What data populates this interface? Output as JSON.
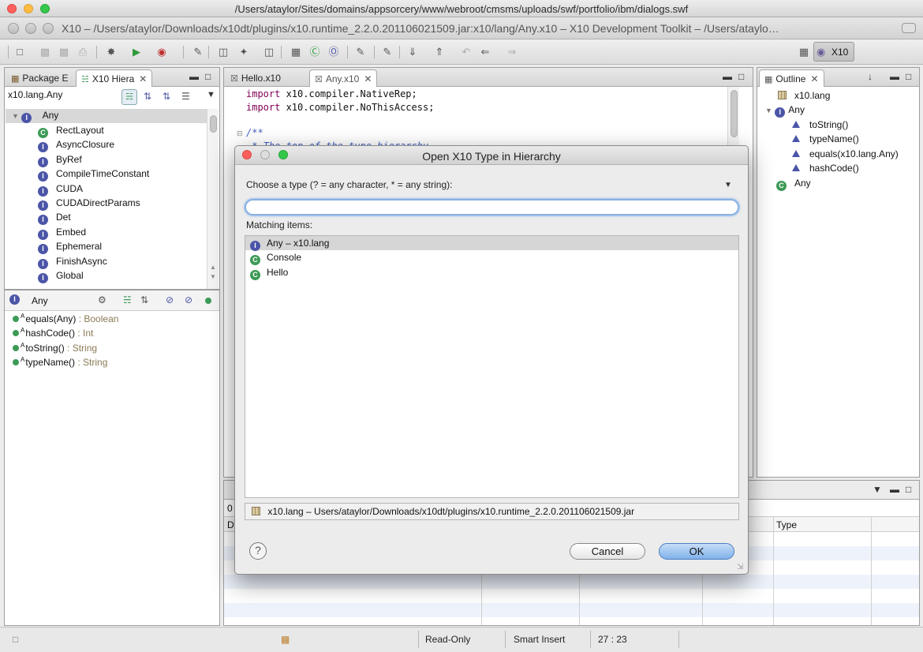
{
  "outer_window": {
    "title": "/Users/ataylor/Sites/domains/appsorcery/www/webroot/cmsms/uploads/swf/portfolio/ibm/dialogs.swf"
  },
  "ide_window": {
    "title": "X10 – /Users/ataylor/Downloads/x10dt/plugins/x10.runtime_2.2.0.201106021509.jar:x10/lang/Any.x10 – X10 Development Toolkit – /Users/ataylo…"
  },
  "toolbar": {
    "perspective_label": "X10"
  },
  "left_panel": {
    "tabs": [
      {
        "label": "Package E"
      },
      {
        "label": "X10 Hiera"
      }
    ],
    "breadcrumb": "x10.lang.Any",
    "hierarchy_root": "Any",
    "hierarchy_items": [
      {
        "label": "RectLayout",
        "kind": "class"
      },
      {
        "label": "AsyncClosure",
        "kind": "interface"
      },
      {
        "label": "ByRef",
        "kind": "interface"
      },
      {
        "label": "CompileTimeConstant",
        "kind": "interface"
      },
      {
        "label": "CUDA",
        "kind": "interface"
      },
      {
        "label": "CUDADirectParams",
        "kind": "interface"
      },
      {
        "label": "Det",
        "kind": "interface"
      },
      {
        "label": "Embed",
        "kind": "interface"
      },
      {
        "label": "Ephemeral",
        "kind": "interface"
      },
      {
        "label": "FinishAsync",
        "kind": "interface"
      },
      {
        "label": "Global",
        "kind": "interface"
      }
    ],
    "members_header": "Any",
    "members": [
      {
        "name": "equals(Any)",
        "type": " : Boolean"
      },
      {
        "name": "hashCode()",
        "type": " : Int"
      },
      {
        "name": "toString()",
        "type": " : String"
      },
      {
        "name": "typeName()",
        "type": " : String"
      }
    ]
  },
  "editor": {
    "tabs": [
      {
        "label": "Hello.x10"
      },
      {
        "label": "Any.x10"
      }
    ],
    "code_lines": [
      {
        "kw": "import",
        "rest": " x10.compiler.NativeRep;"
      },
      {
        "kw": "import",
        "rest": " x10.compiler.NoThisAccess;"
      }
    ],
    "comment_open": "/**",
    "comment_line": " * The top of the type hierarchy"
  },
  "outline": {
    "tab_label": "Outline",
    "package": "x10.lang",
    "type": "Any",
    "methods": [
      "toString()",
      "typeName()",
      "equals(x10.lang.Any)",
      "hashCode()"
    ],
    "class_item": "Any"
  },
  "bottom_panel": {
    "first_tab_fragment": "0",
    "col_fragment": "D",
    "type_header": "Type"
  },
  "dialog": {
    "title": "Open X10 Type in Hierarchy",
    "prompt": "Choose a type (? = any character, * = any string):",
    "input_value": "",
    "matching_label": "Matching items:",
    "items": [
      {
        "name": "Any – x10.lang",
        "kind": "interface",
        "selected": true
      },
      {
        "name": "Console",
        "kind": "class",
        "selected": false
      },
      {
        "name": "Hello",
        "kind": "class",
        "selected": false
      }
    ],
    "location": "x10.lang – Users/ataylor/Downloads/x10dt/plugins/x10.runtime_2.2.0.201106021509.jar",
    "cancel_label": "Cancel",
    "ok_label": "OK"
  },
  "status_bar": {
    "read_only": "Read-Only",
    "insert_mode": "Smart Insert",
    "position": "27 : 23"
  }
}
